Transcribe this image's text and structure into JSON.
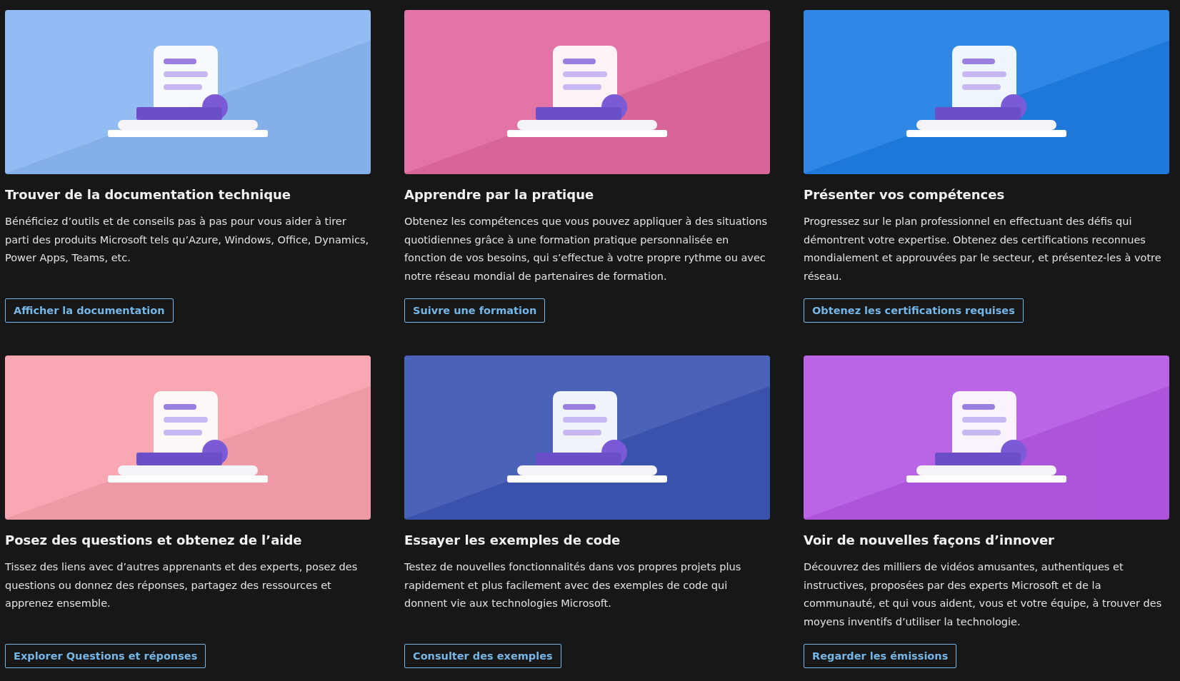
{
  "cards": [
    {
      "title": "Trouver de la documentation technique",
      "description": "Bénéficiez d’outils et de conseils pas à pas pour vous aider à tirer parti des produits Microsoft tels qu’Azure, Windows, Office, Dynamics, Power Apps, Teams, etc.",
      "button": "Afficher la documentation",
      "color": "#8ab6f2"
    },
    {
      "title": "Apprendre par la pratique",
      "description": "Obtenez les compétences que vous pouvez appliquer à des situations quotidiennes grâce à une formation pratique personnalisée en fonction de vos besoins, qui s’effectue à votre propre rythme ou avec notre réseau mondial de partenaires de formation.",
      "button": "Suivre une formation",
      "color": "#e0699e"
    },
    {
      "title": "Présenter vos compétences",
      "description": "Progressez sur le plan professionnel en effectuant des défis qui démontrent votre expertise. Obtenez des certifications reconnues mondialement et approuvées par le secteur, et présentez-les à votre réseau.",
      "button": "Obtenez les certifications requises",
      "color": "#1f7de3"
    },
    {
      "title": "Posez des questions et obtenez de l’aide",
      "description": "Tissez des liens avec d’autres apprenants et des experts, posez des questions ou donnez des réponses, partagez des ressources et apprenez ensemble.",
      "button": "Explorer Questions et réponses",
      "color": "#f7a0ad"
    },
    {
      "title": "Essayer les exemples de code",
      "description": "Testez de nouvelles fonctionnalités dans vos propres projets plus rapidement et plus facilement avec des exemples de code qui donnent vie aux technologies Microsoft.",
      "button": "Consulter des exemples",
      "color": "#3b55b2"
    },
    {
      "title": "Voir de nouvelles façons d’innover",
      "description": "Découvrez des milliers de vidéos amusantes, authentiques et instructives, proposées par des experts Microsoft et de la communauté, et qui vous aident, vous et votre équipe, à trouver des moyens inventifs d’utiliser la technologie.",
      "button": "Regarder les émissions",
      "color": "#b358e4"
    }
  ]
}
